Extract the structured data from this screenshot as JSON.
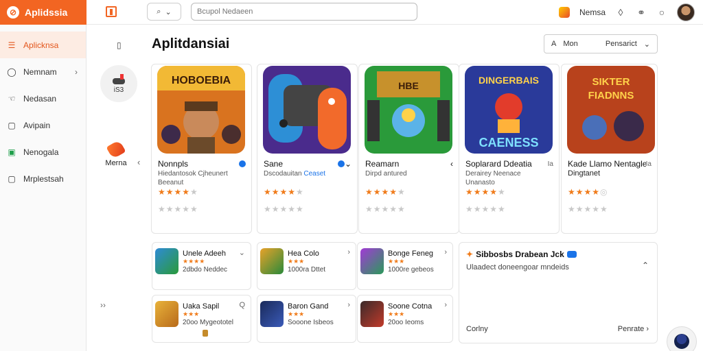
{
  "brand": {
    "name": "Aplidssia",
    "logo_glyph": "⊘"
  },
  "topbar": {
    "filter_icon": "search-icon",
    "search_placeholder": "Bcupol Nedaeen",
    "user_name": "Nemsa",
    "icons": [
      "coin-icon",
      "flame-icon",
      "friends-icon",
      "circle-icon"
    ]
  },
  "sidebar": {
    "items": [
      {
        "label": "Aplicknsa",
        "icon": "list-icon",
        "glyph": "☰",
        "active": true
      },
      {
        "label": "Nemnam",
        "icon": "chat-icon",
        "glyph": "◯",
        "chevron": "›"
      },
      {
        "label": "Nedasan",
        "icon": "hand-icon",
        "glyph": "☜"
      },
      {
        "label": "Avipain",
        "icon": "doc-icon",
        "glyph": "▢"
      },
      {
        "label": "Nenogala",
        "icon": "app-icon",
        "glyph": "▣"
      },
      {
        "label": "Mrplestsah",
        "icon": "frame-icon",
        "glyph": "▢"
      }
    ]
  },
  "secondary": {
    "mini_icon": "▯",
    "circle_label": "iS3",
    "brush_label": "Merna",
    "left_chevron": "‹",
    "double_chevron": "››"
  },
  "main": {
    "title": "Aplitdansiai",
    "sort": {
      "icon": "A",
      "label": "Mon",
      "value": "Pensarict",
      "chevron": "⌄"
    }
  },
  "cards": [
    {
      "title": "Nonnpls",
      "verified": true,
      "desc1": "Hiedantosok Cjheunert",
      "desc2": "Beeanut",
      "link": "",
      "rating": 4,
      "art": "adventure"
    },
    {
      "title": "Sane",
      "verified": true,
      "desc1": "Dscodauitan",
      "desc2": "",
      "link": "Ceaset",
      "rating": 4,
      "art": "controller",
      "chevron": "⌄"
    },
    {
      "title": "Reamarn",
      "verified": false,
      "desc1": "Dirpd antured",
      "desc2": "",
      "link": "",
      "rating": 4,
      "art": "chest",
      "chevron": "‹"
    },
    {
      "title": "Soplarard Ddeatia",
      "verified": false,
      "desc1": "Derairey Neenace",
      "desc2": "Unanasto",
      "link": "",
      "rating": 4,
      "art": "hero",
      "chevron": "Ia"
    },
    {
      "title": "Kade Llamo Nentagle",
      "verified": false,
      "desc1": "Dingtanet",
      "desc2": "",
      "link": "",
      "rating": 4,
      "art": "battle",
      "chevron": "Ia"
    }
  ],
  "mini_rows": [
    {
      "title": "Unele Adeeh",
      "sub": "2dbdo Neddec",
      "tone": "blue",
      "chevron": "⌄"
    },
    {
      "title": "Hea Colo",
      "sub": "1000ra Dttet",
      "tone": "green",
      "chevron": "›"
    },
    {
      "title": "Bonge Feneg",
      "sub": "1000re gebeos",
      "tone": "purple",
      "chevron": "›"
    },
    {
      "title": "Uaka Sapil",
      "sub": "20oo Mygeototel",
      "tone": "gold",
      "chevron": "Q"
    },
    {
      "title": "Baron Gand",
      "sub": "Sooone Isbeos",
      "tone": "navy",
      "chevron": "›"
    },
    {
      "title": "Soone Cotna",
      "sub": "20oo Ieoms",
      "tone": "red",
      "chevron": "›"
    }
  ],
  "panel": {
    "title": "Sibbosbs Drabean Jck",
    "subtitle": "Ulaadect doneengoar mndeids",
    "up_chevron": "⌃",
    "left_label": "Corlny",
    "right_label": "Penrate",
    "right_chevron": "›"
  },
  "colors": {
    "accent": "#f26522",
    "star": "#f07b1a",
    "link": "#1a73e8"
  }
}
